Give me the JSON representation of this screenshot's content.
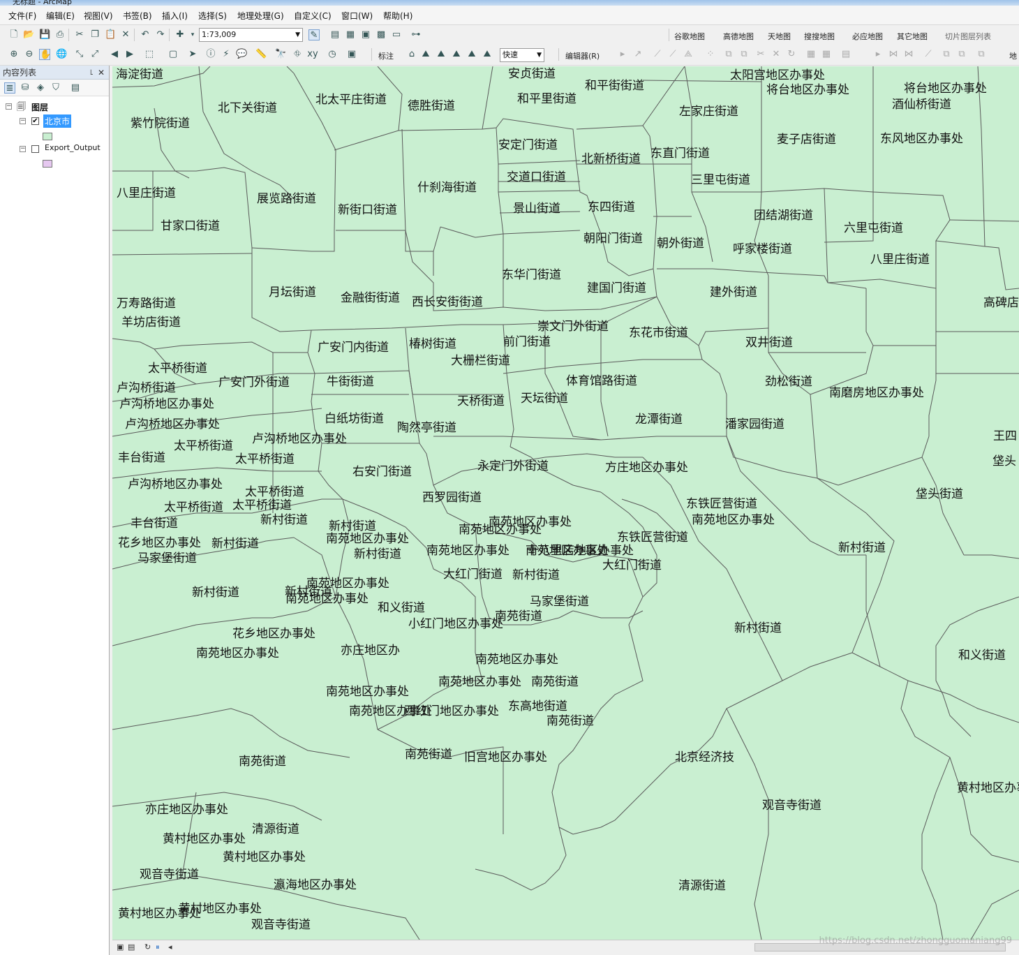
{
  "window": {
    "title": "无标题 - ArcMap"
  },
  "menu": [
    "文件(F)",
    "编辑(E)",
    "视图(V)",
    "书签(B)",
    "插入(I)",
    "选择(S)",
    "地理处理(G)",
    "自定义(C)",
    "窗口(W)",
    "帮助(H)"
  ],
  "toolbar1": {
    "scale": "1:73,009",
    "basemaps": [
      "谷歌地图",
      "高德地图",
      "天地图",
      "搜搜地图",
      "必应地图",
      "其它地图"
    ],
    "tile_list": "切片图层列表"
  },
  "toolbar2": {
    "label_menu": "标注",
    "speed": "快速",
    "editor": "编辑器(R)",
    "right_cut": "地"
  },
  "toc": {
    "title": "内容列表",
    "root": "图层",
    "layers": [
      {
        "name": "北京市",
        "checked": true,
        "color": "#c9efd1"
      },
      {
        "name": "Export_Output",
        "checked": false,
        "color": "#e6c8f0"
      }
    ]
  },
  "map": {
    "fill": "#c9efd1",
    "labels": [
      "海淀街道",
      "安贞街道",
      "太阳宫地区办事处",
      "和平街街道",
      "将台地区办事处",
      "将台地区办事处",
      "北太平庄街道",
      "北下关街道",
      "德胜街道",
      "和平里街道",
      "酒仙桥街道",
      "左家庄街道",
      "紫竹院街道",
      "麦子店街道",
      "东风地区办事处",
      "安定门街道",
      "东直门街道",
      "北新桥街道",
      "八里庄街道",
      "交道口街道",
      "三里屯街道",
      "什刹海街道",
      "展览路街道",
      "景山街道",
      "东四街道",
      "团结湖街道",
      "新街口街道",
      "六里屯街道",
      "甘家口街道",
      "朝阳门街道",
      "朝外街道",
      "呼家楼街道",
      "八里庄街道",
      "东华门街道",
      "建国门街道",
      "月坛街道",
      "建外街道",
      "金融街街道",
      "西长安街街道",
      "万寿路街道",
      "高碑店",
      "羊坊店街道",
      "崇文门外街道",
      "东花市街道",
      "广安门内街道",
      "椿树街道",
      "前门街道",
      "双井街道",
      "大栅栏街道",
      "太平桥街道",
      "体育馆路街道",
      "劲松街道",
      "卢沟桥街道",
      "广安门外街道",
      "牛街街道",
      "南磨房地区办事处",
      "卢沟桥地区办事处",
      "天桥街道",
      "天坛街道",
      "白纸坊街道",
      "卢沟桥地区办事处",
      "龙潭街道",
      "潘家园街道",
      "陶然亭街道",
      "卢沟桥地区办事处",
      "王四",
      "太平桥街道",
      "丰台街道",
      "太平桥街道",
      "右安门街道",
      "永定门外街道",
      "方庄地区办事处",
      "垡头",
      "卢沟桥地区办事处",
      "太平桥街道",
      "垡头街道",
      "西罗园街道",
      "东铁匠营街道",
      "太平桥街道",
      "太平桥街道",
      "新村街道",
      "南苑地区办事处",
      "南苑地区办事处",
      "丰台街道",
      "新村街道",
      "南苑地区办事处",
      "南苑地区办事处",
      "东铁匠营街道",
      "花乡地区办事处",
      "新村街道",
      "南苑地区办事处",
      "南苑地区办事处",
      "十八里店地区办事处",
      "新村街道",
      "马家堡街道",
      "新村街道",
      "南苑地区办事处",
      "大红门街道",
      "大红门街道",
      "新村街道",
      "新村街道",
      "新村街道",
      "南苑地区办事处",
      "马家堡街道",
      "和义街道",
      "南苑街道",
      "小红门地区办事处",
      "新村街道",
      "花乡地区办事处",
      "南苑地区办事处",
      "亦庄地区办",
      "和义街道",
      "南苑地区办事处",
      "南苑地区办事处",
      "南苑街道",
      "南苑地区办事处",
      "南苑地区办事处",
      "东高地街道",
      "南苑街道",
      "西红门地区办事处",
      "南苑街道",
      "南苑街道",
      "旧宫地区办事处",
      "北京经济技",
      "黄村地区办事处",
      "亦庄地区办事处",
      "观音寺街道",
      "清源街道",
      "黄村地区办事处",
      "黄村地区办事处",
      "观音寺街道",
      "瀛海地区办事处",
      "清源街道",
      "黄村地区办事处",
      "黄村地区办事处",
      "观音寺街道"
    ]
  },
  "watermark": "https://blog.csdn.net/zhongguomaniang99"
}
